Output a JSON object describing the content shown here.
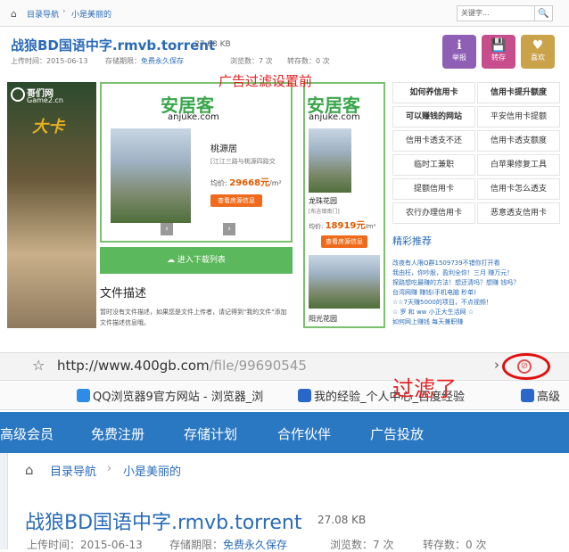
{
  "top": {
    "breadcrumb": [
      "目录导航",
      "小是美丽的"
    ],
    "crumb_sep": "›",
    "search_placeholder": "关键字...",
    "search_icon": "🔍",
    "file_title": "战狼BD国语中字.rmvb.torrent",
    "file_size": "27.08 KB",
    "upload_label": "上传时间：2015-06-13",
    "storage_label": "存储期限：",
    "storage_value": "免费永久保存",
    "views_label": "浏览数：7 次",
    "downloads_label": "转存数：0 次",
    "actions": [
      {
        "label": "举报",
        "icon": "ℹ",
        "color": "#8e5fb5"
      },
      {
        "label": "转存",
        "icon": "💾",
        "color": "#c84d8c"
      },
      {
        "label": "喜欢",
        "icon": "♥",
        "color": "#c9a24a"
      }
    ]
  },
  "ads": {
    "overlay_caption": "广告过滤设置前",
    "game_logo": "哥们网",
    "game_logo_sub": "Game2.cn",
    "game_title": "大卡",
    "card1": {
      "brand": "安居客",
      "domain": "anjuke.com",
      "estate": "桃源居",
      "address": "[江江三路与桃源四路交",
      "price_label": "均价:",
      "price": "29668元",
      "unit": "/m²",
      "btn": "查看房源信息"
    },
    "card2": {
      "brand": "安居客",
      "domain": "anjuke.com",
      "estate": "龙珠花园",
      "address": "[布吉镇南门]",
      "price_label": "均价:",
      "price": "18919元",
      "unit": "/m²",
      "btn": "查看房源信息",
      "estate2": "阳光花园"
    },
    "prev": "‹",
    "next": "›",
    "download_bar": "进入下载列表",
    "download_icon": "☁",
    "desc_title": "文件描述",
    "desc_text": "暂时没有文件描述，如果您是文件上传者，请记得到\"我的文件\"添加文件描述信息哦。",
    "links": [
      [
        "如何养信用卡",
        "信用卡提升额度"
      ],
      [
        "可以赚钱的网站",
        "平安信用卡提额"
      ],
      [
        "信用卡透支不还",
        "信用卡透支额度"
      ],
      [
        "临时工兼职",
        "白苹果修复工具"
      ],
      [
        "提额信用卡",
        "信用卡怎么透支"
      ],
      [
        "农行办理信用卡",
        "恶意透支信用卡"
      ]
    ],
    "featured_title": "精彩推荐",
    "featured_lines": [
      "改夜有人限Q群1509739不错你打开看",
      "我由枉，你吵股，盈利全你！三月 赚万元！",
      "探路想吃最赚的方法！想还清吗？想赚 钱吗？",
      "台湾网赚 赚钱(手机电脑 秒单)",
      "☆☆7天赚5000的项目，不点视频！",
      "☆ 罗 和 ww 小正大生活网 ☆",
      "如何网上赚钱 每天兼职赚"
    ]
  },
  "browser": {
    "url_main": "http://www.400gb.com",
    "url_path": "/file/99690545",
    "star_icon": "☆",
    "chev": "›",
    "filter_icon": "⊘",
    "overlay_caption": "过滤了",
    "bookmarks": [
      {
        "label": "QQ浏览器9官方网站 - 浏览器_浏",
        "color": "#2d8ce6"
      },
      {
        "label": "我的经验_个人中心_百度经验",
        "color": "#2b66c9"
      },
      {
        "label": "高级",
        "color": "#2b66c9"
      }
    ],
    "nav": [
      "高级会员",
      "免费注册",
      "存储计划",
      "合作伙伴",
      "广告投放"
    ],
    "breadcrumb": [
      "目录导航",
      "小是美丽的"
    ],
    "crumb_sep": "›",
    "file_title": "战狼BD国语中字.rmvb.torrent",
    "file_size": "27.08 KB",
    "upload_label": "上传时间：2015-06-13",
    "storage_label": "存储期限：",
    "storage_value": "免费永久保存",
    "views_label": "浏览数：7 次",
    "downloads_label": "转存数：0 次"
  }
}
